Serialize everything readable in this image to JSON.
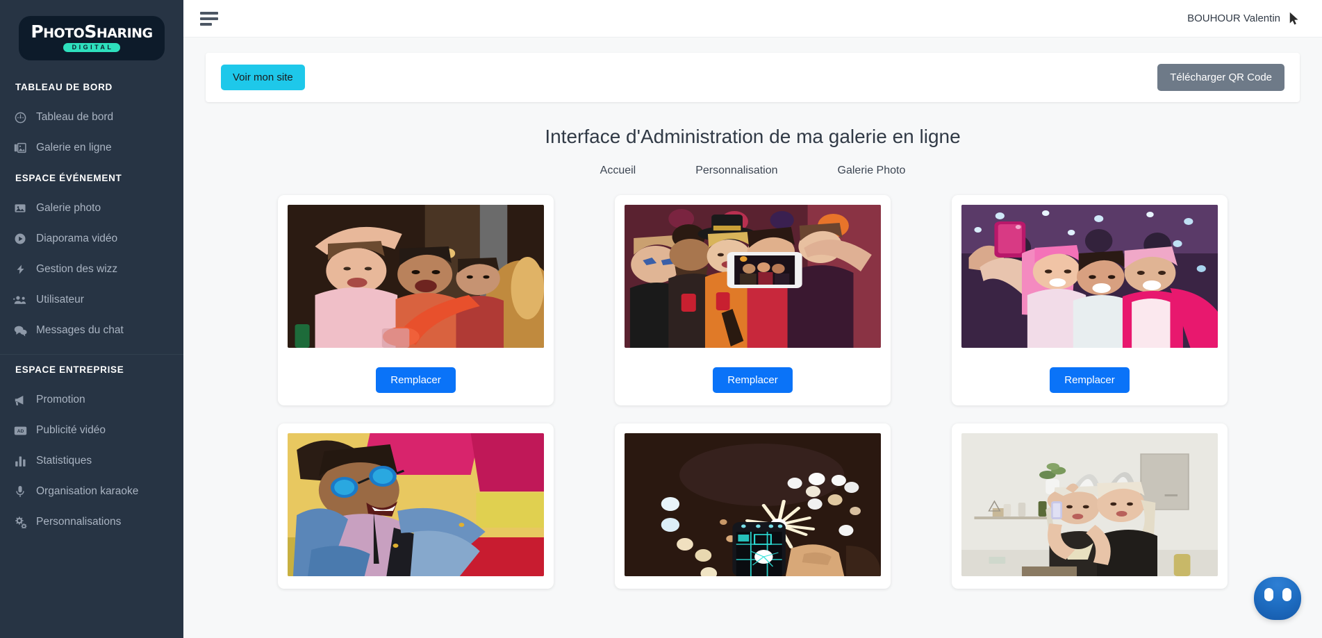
{
  "brand": {
    "logo_main_1": "P",
    "logo_main_2": "HOTO",
    "logo_main_3": "S",
    "logo_main_4": "HARING",
    "logo_sub": "DIGITAL"
  },
  "sidebar": {
    "sections": [
      {
        "title": "TABLEAU DE BORD",
        "items": [
          {
            "label": "Tableau de bord",
            "icon": "gauge-icon"
          },
          {
            "label": "Galerie en ligne",
            "icon": "images-stack-icon"
          }
        ]
      },
      {
        "title": "ESPACE ÉVÉNEMENT",
        "items": [
          {
            "label": "Galerie photo",
            "icon": "image-icon"
          },
          {
            "label": "Diaporama vidéo",
            "icon": "play-circle-icon"
          },
          {
            "label": "Gestion des wizz",
            "icon": "bolt-icon"
          },
          {
            "label": "Utilisateur",
            "icon": "users-icon"
          },
          {
            "label": "Messages du chat",
            "icon": "chat-bubbles-icon"
          }
        ]
      },
      {
        "title": "ESPACE ENTREPRISE",
        "items": [
          {
            "label": "Promotion",
            "icon": "megaphone-icon"
          },
          {
            "label": "Publicité vidéo",
            "icon": "ad-badge-icon"
          },
          {
            "label": "Statistiques",
            "icon": "bar-chart-icon"
          },
          {
            "label": "Organisation karaoke",
            "icon": "microphone-icon"
          },
          {
            "label": "Personnalisations",
            "icon": "gears-icon"
          }
        ]
      }
    ]
  },
  "topbar": {
    "menu_icon": "hamburger-icon",
    "user_name": "BOUHOUR Valentin",
    "cursor_icon": "mouse-pointer-icon"
  },
  "action_bar": {
    "view_site_label": "Voir mon site",
    "qr_label": "Télécharger QR Code"
  },
  "main": {
    "title": "Interface d'Administration de ma galerie en ligne",
    "tabs": [
      {
        "label": "Accueil"
      },
      {
        "label": "Personnalisation"
      },
      {
        "label": "Galerie Photo"
      }
    ],
    "replace_label": "Remplacer",
    "cards": [
      {
        "photo": "friends-cheering-bar-selfie",
        "button": "Remplacer"
      },
      {
        "photo": "halloween-party-phone-selfie",
        "button": "Remplacer"
      },
      {
        "photo": "pink-hair-women-club-selfie",
        "button": "Remplacer"
      },
      {
        "photo": "man-blue-sunglasses-denim-selfie",
        "button": ""
      },
      {
        "photo": "sparkler-night-phone-photo",
        "button": ""
      },
      {
        "photo": "two-women-party-hats-kitchen-selfie",
        "button": ""
      }
    ]
  },
  "chat_widget": {
    "icon": "chat-avatar-icon"
  },
  "colors": {
    "sidebar_bg": "#273444",
    "accent_cyan": "#1ec8ea",
    "accent_blue": "#0a73f8",
    "grey_button": "#6e7a88",
    "logo_teal": "#2ee0bd",
    "content_bg": "#f7f8f9"
  }
}
